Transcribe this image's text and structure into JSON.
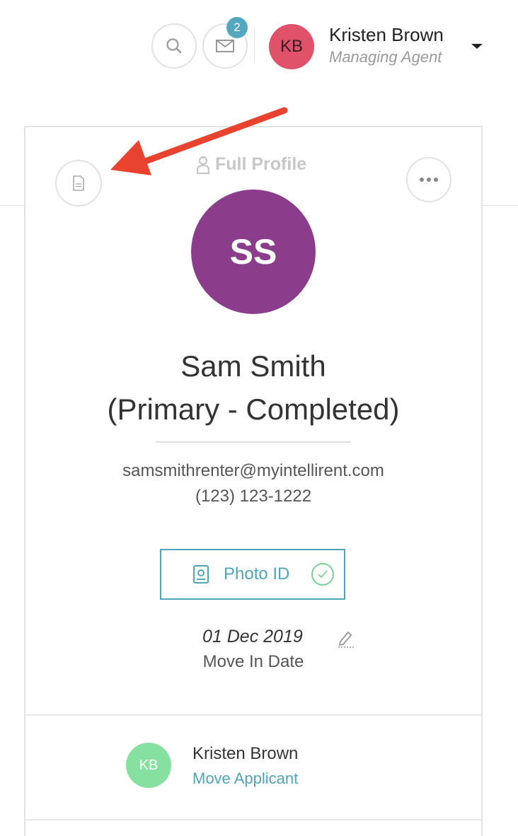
{
  "header": {
    "unread_count": "2",
    "user": {
      "initials": "KB",
      "name": "Kristen Brown",
      "role": "Managing Agent"
    }
  },
  "profile": {
    "view_label": "Full Profile",
    "initials": "SS",
    "name": "Sam Smith",
    "status_line": "(Primary - Completed)",
    "email": "samsmithrenter@myintellirent.com",
    "phone": "(123) 123-1222",
    "photo_id_label": "Photo ID",
    "move_in_date": "01 Dec 2019",
    "move_in_label": "Move In Date"
  },
  "assigned_agent": {
    "initials": "KB",
    "name": "Kristen Brown",
    "action_label": "Move Applicant"
  },
  "colors": {
    "accent": "#4ea5b7",
    "user_avatar": "#e0526a",
    "profile_avatar": "#8b3c8b",
    "agent_avatar": "#86e1a0",
    "annotation_arrow": "#e8432e"
  },
  "icons": [
    "search-icon",
    "mail-icon",
    "chevron-down-icon",
    "document-icon",
    "more-icon",
    "person-icon",
    "id-card-icon",
    "check-icon",
    "pencil-icon",
    "annotation-arrow"
  ]
}
